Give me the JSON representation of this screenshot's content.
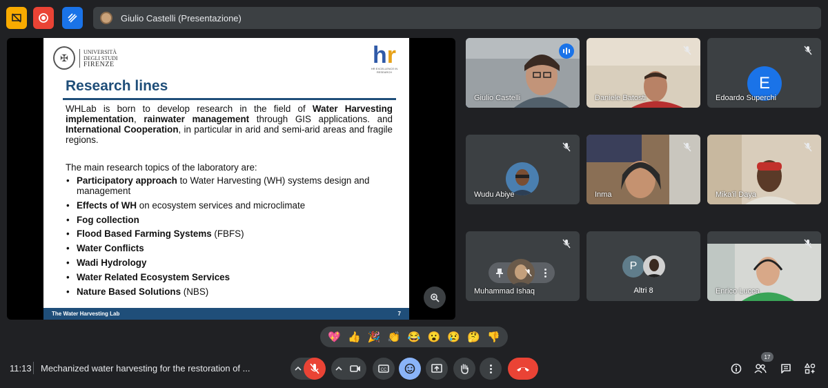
{
  "presenting": {
    "label": "Giulio Castelli (Presentazione)"
  },
  "slide": {
    "university_line1": "UNIVERSITÀ",
    "university_line2": "DEGLI STUDI",
    "university_line3": "FIRENZE",
    "hr_subtitle": "HR EXCELLENCE IN RESEARCH",
    "title": "Research lines",
    "intro": {
      "p1": "WHLab is born to develop research in the field of ",
      "b1": "Water Harvesting implementation",
      "p2": ", ",
      "b2": "rainwater management",
      "p3": " through GIS applications. and ",
      "b3": "International Cooperation",
      "p4": ", in particular in arid and semi-arid areas and fragile regions."
    },
    "topics_lead": "The main research topics of the laboratory are:",
    "topics": [
      {
        "bold": "Participatory approach",
        "rest": " to Water Harvesting (WH) systems design and management"
      },
      {
        "bold": "Effects of WH",
        "rest": " on ecosystem services and microclimate"
      },
      {
        "bold": "Fog collection",
        "rest": ""
      },
      {
        "bold": "Flood Based Farming Systems",
        "rest": " (FBFS)"
      },
      {
        "bold": "Water Conflicts",
        "rest": ""
      },
      {
        "bold": "Wadi Hydrology",
        "rest": ""
      },
      {
        "bold": "Water Related Ecosystem Services",
        "rest": ""
      },
      {
        "bold": "Nature Based Solutions",
        "rest": " (NBS)"
      }
    ],
    "footer_left": "The Water Harvesting Lab",
    "footer_page": "7"
  },
  "participants": [
    {
      "name": "Giulio Castelli"
    },
    {
      "name": "Daniele Batosti"
    },
    {
      "name": "Edoardo Superchi",
      "initial": "E"
    },
    {
      "name": "Wudu Abiye"
    },
    {
      "name": "Inma"
    },
    {
      "name": "Mika'il Daya"
    },
    {
      "name": "Muhammad Ishaq"
    },
    {
      "name": "Altri 8",
      "initial": "P"
    },
    {
      "name": "Enrico Lucca"
    }
  ],
  "reactions": [
    "💖",
    "👍",
    "🎉",
    "👏",
    "😂",
    "😮",
    "😢",
    "🤔",
    "👎"
  ],
  "bottom": {
    "time": "11:13",
    "meeting_title": "Mechanized water harvesting for the restoration of ...",
    "people_count": "17"
  },
  "colors": {
    "accent": "#8ab4f8",
    "end_call": "#ea4335",
    "avatar_blue": "#1a73e8",
    "slide_blue": "#1f4e79"
  }
}
